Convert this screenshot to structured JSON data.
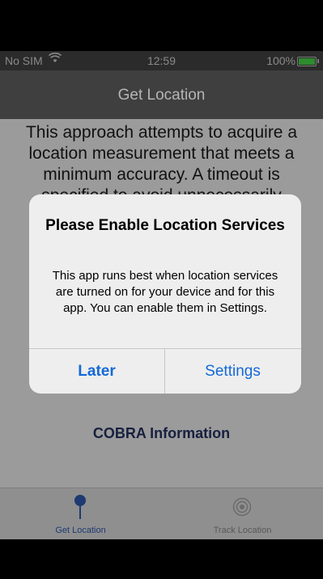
{
  "status_bar": {
    "carrier": "No SIM",
    "wifi_icon": "wifi-icon",
    "time": "12:59",
    "battery": "100%",
    "battery_level": 1.0,
    "battery_color": "#2e8b2e"
  },
  "nav": {
    "title": "Get Location"
  },
  "content": {
    "description": "This approach attempts to acquire a location measurement that meets a minimum accuracy. A timeout is specified to avoid unnecessarily",
    "cobra_link": "COBRA Information"
  },
  "tabs": [
    {
      "label": "Get Location",
      "icon": "map-pin-icon",
      "selected": true
    },
    {
      "label": "Track Location",
      "icon": "target-icon",
      "selected": false
    }
  ],
  "alert": {
    "title": "Please Enable Location Services",
    "message": "This app runs best when location services are turned on for your device and for this app. You can enable them in Settings.",
    "buttons": {
      "later": "Later",
      "settings": "Settings"
    },
    "accent_color": "#1469d6"
  }
}
